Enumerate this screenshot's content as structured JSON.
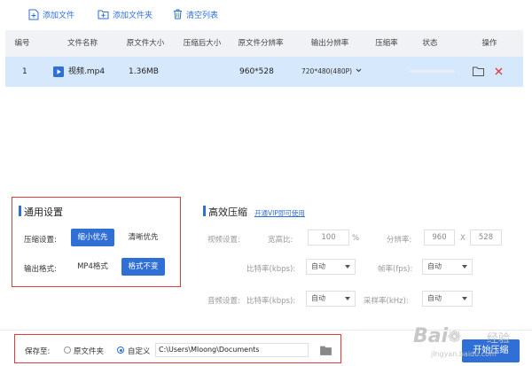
{
  "toolbar": {
    "add_file": "添加文件",
    "add_folder": "添加文件夹",
    "clear_list": "清空列表"
  },
  "table": {
    "headers": [
      "编号",
      "文件名称",
      "原文件大小",
      "压缩后大小",
      "原文件分辨率",
      "输出分辨率",
      "压缩率",
      "状态",
      "操作"
    ],
    "rows": [
      {
        "index": "1",
        "filename": "视频.mp4",
        "orig_size": "1.36MB",
        "compressed_size": "",
        "orig_resolution": "960*528",
        "output_resolution": "720*480(480P)",
        "ratio": "",
        "progress": 0
      }
    ]
  },
  "general": {
    "title": "通用设置",
    "compress_label": "压缩设置:",
    "compress_opt_small": "缩小优先",
    "compress_opt_clear": "清晰优先",
    "format_label": "输出格式:",
    "format_mp4": "MP4格式",
    "format_keep": "格式不变"
  },
  "efficient": {
    "title": "高效压缩",
    "vip_link": "开通VIP即可使用",
    "video_settings_label": "视频设置:",
    "aspect_label": "宽高比:",
    "aspect_value": "100",
    "aspect_unit": "%",
    "resolution_label": "分辨率:",
    "res_w": "960",
    "res_x": "X",
    "res_h": "528",
    "bitrate_label": "比特率(kbps):",
    "bitrate_value": "自动",
    "framerate_label": "帧率(fps):",
    "framerate_value": "自动",
    "audio_settings_label": "音频设置:",
    "audio_bitrate_label": "比特率(kbps):",
    "audio_bitrate_value": "自动",
    "samplerate_label": "采样率(kHz):",
    "samplerate_value": "自动"
  },
  "save": {
    "label": "保存至:",
    "opt_original": "原文件夹",
    "opt_custom": "自定义",
    "path": "C:\\Users\\Mloong\\Documents",
    "start_button": "开始压缩"
  },
  "watermark": {
    "brand_a": "Bai",
    "brand_b": "经验",
    "url": "jingyan.baidu.com"
  },
  "colors": {
    "accent": "#2f6fd6",
    "highlight_row": "#d6e8fb",
    "delete_red": "#e53a3a",
    "annotation_red": "#e53a3a"
  }
}
